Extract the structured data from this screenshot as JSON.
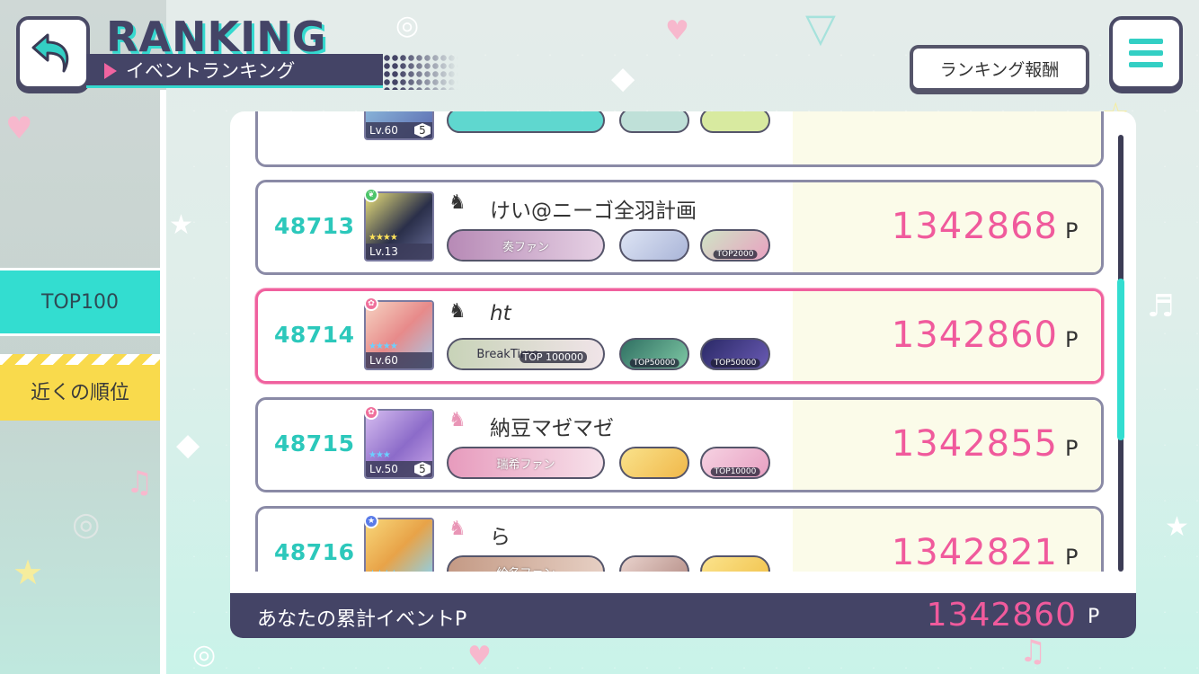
{
  "header": {
    "title": "RANKING",
    "subtitle": "イベントランキング",
    "reward_button": "ランキング報酬"
  },
  "sidebar": {
    "tabs": [
      {
        "label": "TOP100",
        "selected": false
      },
      {
        "label": "近くの順位",
        "selected": true
      }
    ]
  },
  "ranking": {
    "partial_top": {
      "level": "Lv.60",
      "badge": "5"
    },
    "rows": [
      {
        "rank": "48713",
        "name": "けい@ニーゴ全羽計画",
        "score": "1342868",
        "unit": "P",
        "level": "Lv.13",
        "badge": "",
        "self": false,
        "plates": [
          {
            "label": "奏ファン",
            "tag": "",
            "color": "#c7a0c4"
          },
          {
            "label": "",
            "tag": "",
            "color": "#b8c9e6"
          },
          {
            "label": "",
            "tag": "TOP2000",
            "color": "#9cc79a"
          }
        ]
      },
      {
        "rank": "48714",
        "name": "ht",
        "score": "1342860",
        "unit": "P",
        "level": "Lv.60",
        "badge": "",
        "self": true,
        "plates": [
          {
            "label": "BreakTime",
            "tag": "TOP 100000",
            "color": "#d6d7c3"
          },
          {
            "label": "",
            "tag": "TOP50000",
            "color": "#5aa884"
          },
          {
            "label": "",
            "tag": "TOP50000",
            "color": "#3b3a78"
          }
        ]
      },
      {
        "rank": "48715",
        "name": "納豆マゼマゼ",
        "score": "1342855",
        "unit": "P",
        "level": "Lv.50",
        "badge": "5",
        "self": false,
        "plates": [
          {
            "label": "瑞希ファン",
            "tag": "",
            "color": "#e8a7c3"
          },
          {
            "label": "",
            "tag": "",
            "color": "#f4cf63"
          },
          {
            "label": "",
            "tag": "TOP10000",
            "color": "#e9b3cf"
          }
        ]
      },
      {
        "rank": "48716",
        "name": "ら",
        "score": "1342821",
        "unit": "P",
        "level": "",
        "badge": "",
        "self": false,
        "plates": [
          {
            "label": "絵名ファン",
            "tag": "",
            "color": "#c49a85"
          },
          {
            "label": "",
            "tag": "",
            "color": "#d6b4ae"
          },
          {
            "label": "",
            "tag": "",
            "color": "#f5d36a"
          }
        ]
      }
    ]
  },
  "footer": {
    "label": "あなたの累計イベントP",
    "score": "1342860",
    "unit": "P"
  },
  "colors": {
    "accent_teal": "#33ddd0",
    "accent_pink": "#f05a9c",
    "dark": "#444466"
  }
}
